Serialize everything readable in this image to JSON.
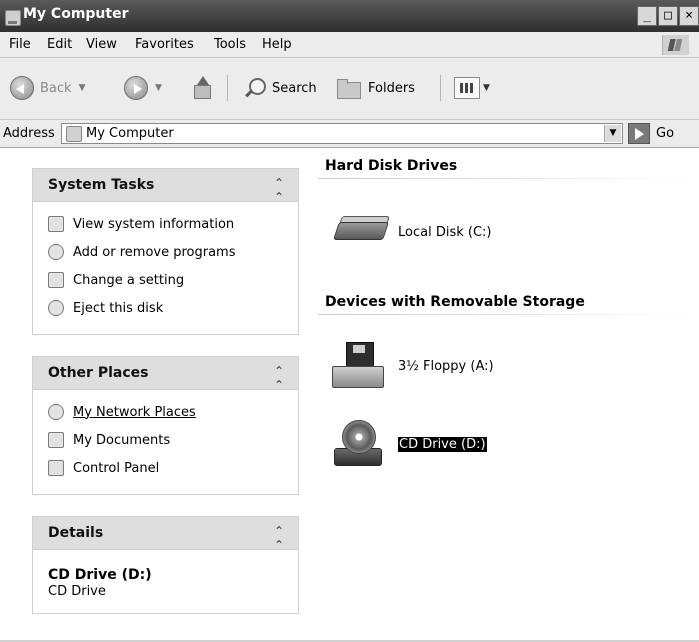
{
  "window": {
    "title": "My Computer",
    "controls": {
      "minimize": "_",
      "maximize": "□",
      "close": "×"
    }
  },
  "menu": [
    "File",
    "Edit",
    "View",
    "Favorites",
    "Tools",
    "Help"
  ],
  "toolbar": {
    "back_label": "Back",
    "search_label": "Search",
    "folders_label": "Folders"
  },
  "address": {
    "label": "Address",
    "value": "My Computer",
    "go_label": "Go"
  },
  "left_pane": {
    "system_tasks": {
      "title": "System Tasks",
      "items": [
        "View system information",
        "Add or remove programs",
        "Change a setting",
        "Eject this disk"
      ]
    },
    "other_places": {
      "title": "Other Places",
      "items": [
        "My Network Places",
        "My Documents",
        "Control Panel"
      ]
    },
    "details": {
      "title": "Details",
      "name": "CD Drive (D:)",
      "type": "CD Drive"
    }
  },
  "content": {
    "sections": [
      {
        "title": "Hard Disk Drives",
        "items": [
          "Local Disk (C:)"
        ]
      },
      {
        "title": "Devices with Removable Storage",
        "items": [
          "3½ Floppy (A:)",
          "CD Drive (D:)"
        ]
      }
    ],
    "selected_item": "CD Drive (D:)"
  },
  "icons": {
    "title": "computer-icon",
    "back": "back-arrow-icon",
    "forward": "forward-arrow-icon",
    "up": "up-folder-icon",
    "search": "search-icon",
    "folders": "folders-icon",
    "views": "views-icon",
    "go": "go-arrow-icon",
    "collapse": "chevron-up-icon"
  }
}
